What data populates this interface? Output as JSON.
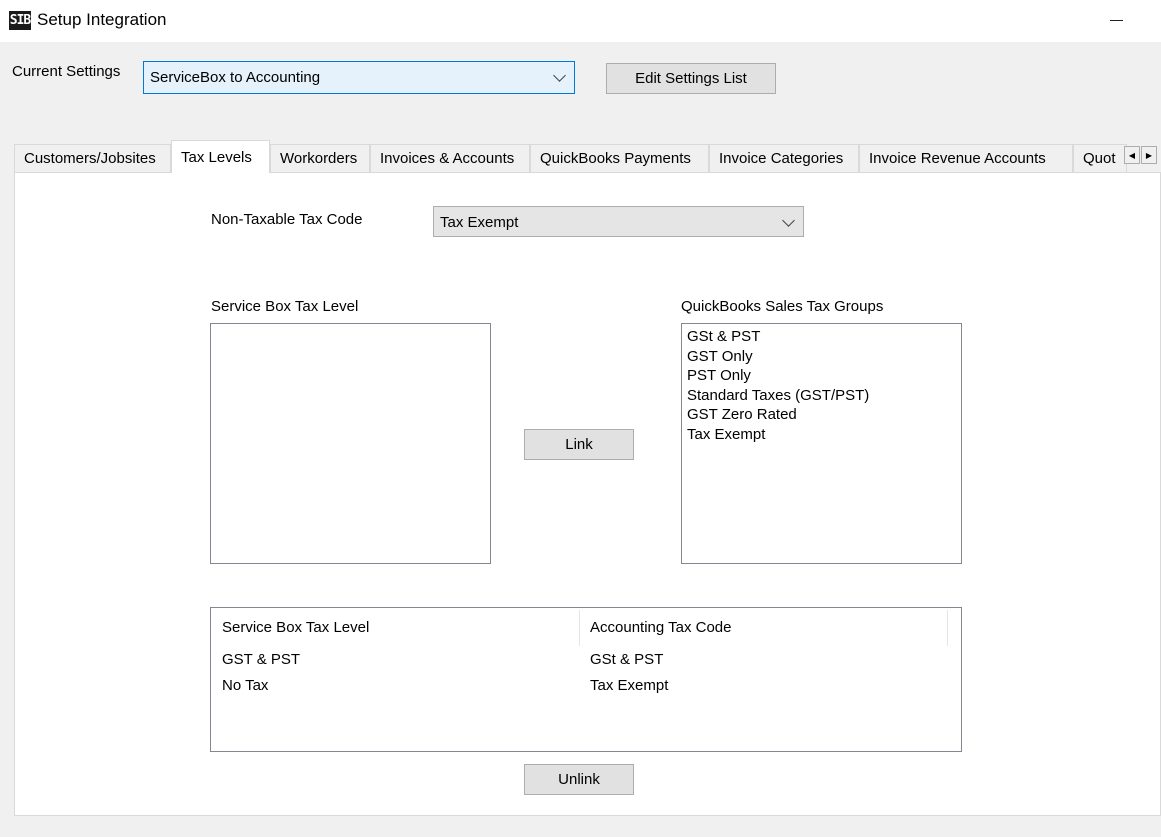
{
  "window": {
    "icon_text": "SIB",
    "title": "Setup Integration"
  },
  "current_settings": {
    "label": "Current Settings",
    "selected": "ServiceBox to Accounting",
    "edit_button": "Edit Settings List"
  },
  "tabs": [
    {
      "label": "Customers/Jobsites",
      "active": false
    },
    {
      "label": "Tax Levels",
      "active": true
    },
    {
      "label": "Workorders",
      "active": false
    },
    {
      "label": "Invoices & Accounts",
      "active": false
    },
    {
      "label": "QuickBooks Payments",
      "active": false
    },
    {
      "label": "Invoice Categories",
      "active": false
    },
    {
      "label": "Invoice Revenue Accounts",
      "active": false
    },
    {
      "label": "Quot",
      "active": false
    }
  ],
  "tab_scroll": {
    "left": "◀",
    "right": "▶"
  },
  "tax_levels": {
    "non_taxable_label": "Non-Taxable Tax Code",
    "non_taxable_value": "Tax Exempt",
    "service_box_list_label": "Service Box Tax Level",
    "service_box_items": [],
    "quickbooks_list_label": "QuickBooks Sales Tax Groups",
    "quickbooks_items": [
      "GSt & PST",
      "GST Only",
      "PST Only",
      "Standard Taxes (GST/PST)",
      "GST Zero Rated",
      "Tax Exempt"
    ],
    "link_button": "Link",
    "unlink_button": "Unlink",
    "link_table": {
      "columns": [
        "Service Box Tax Level",
        "Accounting Tax Code"
      ],
      "rows": [
        [
          "GST & PST",
          "GSt & PST"
        ],
        [
          "No Tax",
          "Tax Exempt"
        ]
      ]
    }
  }
}
